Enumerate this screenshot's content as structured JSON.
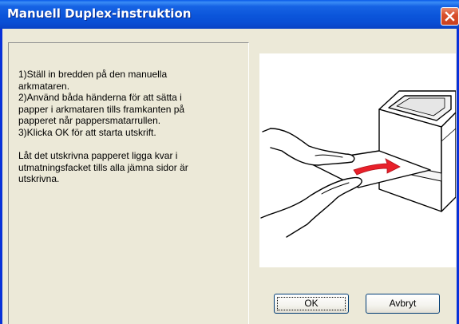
{
  "window": {
    "title": "Manuell Duplex-instruktion"
  },
  "instructions": {
    "lines": [
      "1)Ställ in bredden på den manuella",
      "arkmataren.",
      "2)Använd båda händerna för att sätta i",
      "papper i arkmataren tills framkanten på",
      "papperet når pappersmatarrullen.",
      "3)Klicka OK för att starta utskrift."
    ],
    "note_lines": [
      "Låt det utskrivna papperet ligga kvar i",
      "utmatningsfacket tills alla jämna sidor är",
      "utskrivna."
    ]
  },
  "buttons": {
    "ok_label": "OK",
    "cancel_label": "Avbryt"
  },
  "icons": {
    "close": "close-icon",
    "illustration": "printer-hands-illustration"
  },
  "colors": {
    "title_bar": "#0a4ed4",
    "close_button": "#d9502c",
    "dialog_background": "#ece9d8",
    "arrow": "#e8202a"
  }
}
